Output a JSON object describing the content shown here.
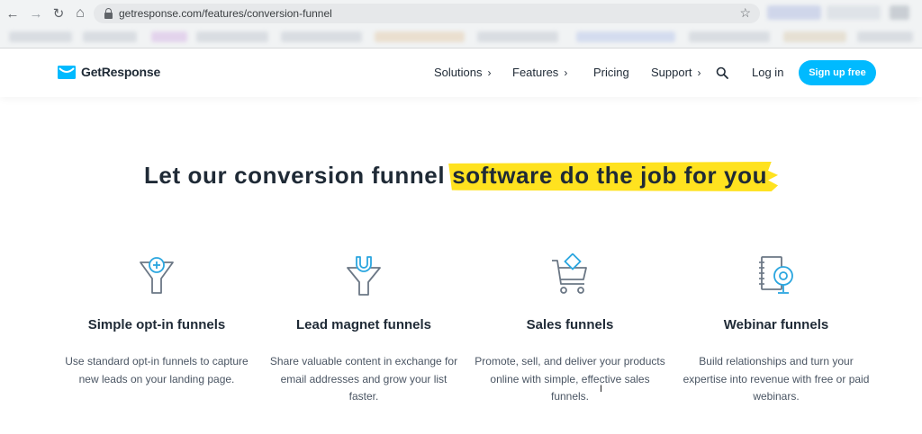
{
  "browser": {
    "url": "getresponse.com/features/conversion-funnel",
    "back_icon": "←",
    "forward_icon": "→",
    "reload_icon": "↻",
    "home_icon": "⌂",
    "star_icon": "☆"
  },
  "header": {
    "logo_text": "GetResponse",
    "nav": {
      "solutions": "Solutions",
      "features": "Features",
      "pricing": "Pricing",
      "support": "Support",
      "chevron": "›"
    },
    "login": "Log in",
    "signup": "Sign up free"
  },
  "hero": {
    "headline_plain": "Let our conversion funnel",
    "headline_highlight": "software do the job for you",
    "highlight_color": "#ffe21f"
  },
  "features": [
    {
      "title": "Simple opt-in funnels",
      "description": "Use standard opt-in funnels to capture new leads on your landing page.",
      "icon": "funnel-plus-icon"
    },
    {
      "title": "Lead magnet funnels",
      "description": "Share valuable content in exchange for email addresses and grow your list faster.",
      "icon": "funnel-magnet-icon"
    },
    {
      "title": "Sales funnels",
      "description": "Promote, sell, and deliver your products online with simple, effective sales funnels.",
      "icon": "shopping-cart-icon"
    },
    {
      "title": "Webinar funnels",
      "description": "Build relationships and turn your expertise into revenue with free or paid webinars.",
      "icon": "webcam-notebook-icon"
    }
  ],
  "colors": {
    "accent": "#00baff",
    "text": "#1f2a36",
    "icon_blue": "#2ba6df",
    "icon_gray": "#6b7785"
  }
}
